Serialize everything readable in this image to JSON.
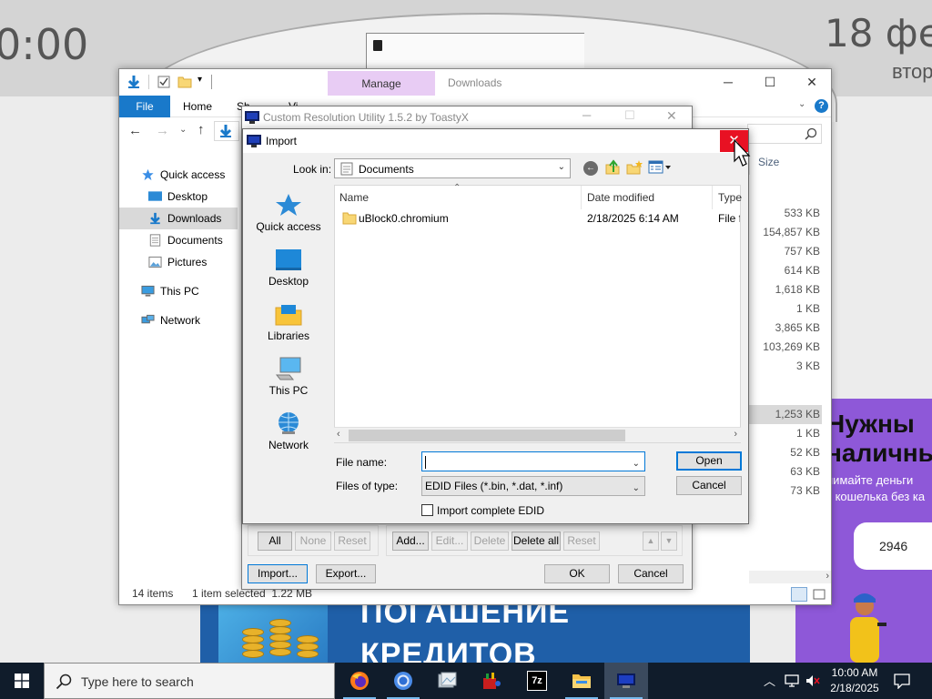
{
  "background_page": {
    "clock_fragment": "0:00",
    "date_fragment": "18 фе",
    "weekday_fragment": "втор",
    "ad_left_line1": "ПОГАШЕНИЕ",
    "ad_left_line2": "КРЕДИТОВ",
    "ad_right_line1": "Нужны",
    "ad_right_line2": "наличны",
    "ad_right_sub1": "нимайте деньги",
    "ad_right_sub2": "з кошелька без ка",
    "ad_right_number": "2946"
  },
  "explorer": {
    "manage_tab": "Manage",
    "title": "Downloads",
    "file_tab": "File",
    "home_tab": "Home",
    "share_tab_fragment": "Sh",
    "view_tab_fragment": "Vi",
    "sidebar": [
      {
        "label": "Quick access",
        "icon": "star-icon"
      },
      {
        "label": "Desktop",
        "icon": "desktop-icon"
      },
      {
        "label": "Downloads",
        "icon": "download-icon",
        "selected": true
      },
      {
        "label": "Documents",
        "icon": "document-icon"
      },
      {
        "label": "Pictures",
        "icon": "pictures-icon"
      },
      {
        "label": "This PC",
        "icon": "computer-icon"
      },
      {
        "label": "Network",
        "icon": "network-icon"
      }
    ],
    "size_header": "Size",
    "sizes": [
      "533 KB",
      "154,857 KB",
      "757 KB",
      "614 KB",
      "1,618 KB",
      "1 KB",
      "3,865 KB",
      "103,269 KB",
      "3 KB",
      "1,253 KB",
      "1 KB",
      "52 KB",
      "63 KB",
      "73 KB"
    ],
    "status_items": "14 items",
    "status_selected": "1 item selected  1.22 MB"
  },
  "cru": {
    "title": "Custom Resolution Utility 1.5.2 by ToastyX",
    "left_buttons": [
      "All",
      "None",
      "Reset"
    ],
    "right_buttons": [
      "Add...",
      "Edit...",
      "Delete",
      "Delete all",
      "Reset"
    ],
    "import_button": "Import...",
    "export_button": "Export...",
    "ok_button": "OK",
    "cancel_button": "Cancel"
  },
  "import_dialog": {
    "title": "Import",
    "look_in_label": "Look in:",
    "look_in_value": "Documents",
    "places": [
      {
        "label": "Quick access",
        "icon": "quick-access-star-icon"
      },
      {
        "label": "Desktop",
        "icon": "desktop-icon"
      },
      {
        "label": "Libraries",
        "icon": "libraries-icon"
      },
      {
        "label": "This PC",
        "icon": "this-pc-icon"
      },
      {
        "label": "Network",
        "icon": "network-globe-icon"
      }
    ],
    "columns": {
      "name": "Name",
      "date_modified": "Date modified",
      "type": "Type"
    },
    "files": [
      {
        "name": "uBlock0.chromium",
        "date_modified": "2/18/2025 6:14 AM",
        "type": "File fo"
      }
    ],
    "file_name_label": "File name:",
    "file_name_value": "",
    "files_of_type_label": "Files of type:",
    "files_of_type_value": "EDID Files (*.bin, *.dat, *.inf)",
    "checkbox_label": "Import complete EDID",
    "checkbox_checked": false,
    "open_button": "Open",
    "cancel_button": "Cancel"
  },
  "taskbar": {
    "search_placeholder": "Type here to search",
    "apps": [
      "firefox-icon",
      "chrome-icon",
      "photos-icon",
      "paint-icon",
      "7zip-icon",
      "file-explorer-icon",
      "cru-icon"
    ],
    "time": "10:00 AM",
    "date": "2/18/2025"
  },
  "colors": {
    "accent": "#1979ca",
    "close_red": "#e81123",
    "taskbar": "#101c2b",
    "manage_tab": "#e8ccf4"
  }
}
